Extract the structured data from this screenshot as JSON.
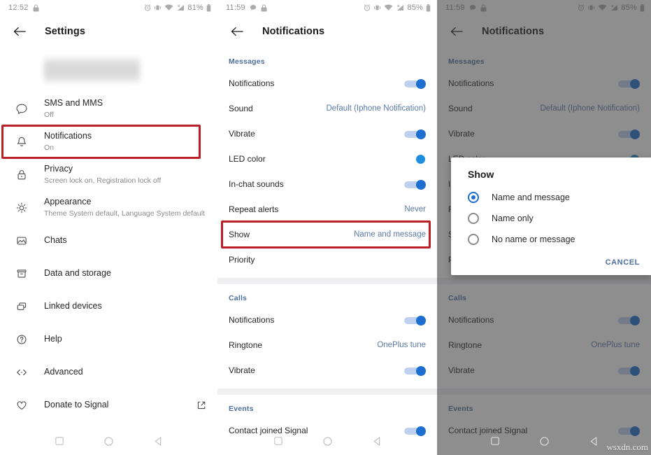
{
  "panels": {
    "left": {
      "statusbar": {
        "time": "12:52",
        "battery": "81%",
        "icons": [
          "lock-icon",
          "alarm-icon",
          "vibrate-icon",
          "wifi-icon",
          "signal-icon",
          "battery-icon"
        ]
      },
      "appbar": {
        "title": "Settings",
        "back": "back-arrow-icon"
      },
      "profile_redacted": true,
      "items": [
        {
          "icon": "chat-bubble-icon",
          "label": "SMS and MMS",
          "sub": "Off"
        },
        {
          "icon": "bell-icon",
          "label": "Notifications",
          "sub": "On",
          "highlighted": true
        },
        {
          "icon": "lock-icon",
          "label": "Privacy",
          "sub": "Screen lock on, Registration lock off"
        },
        {
          "icon": "brightness-icon",
          "label": "Appearance",
          "sub": "Theme System default, Language System default"
        },
        {
          "icon": "image-icon",
          "label": "Chats",
          "sub": ""
        },
        {
          "icon": "archive-icon",
          "label": "Data and storage",
          "sub": ""
        },
        {
          "icon": "devices-icon",
          "label": "Linked devices",
          "sub": ""
        },
        {
          "icon": "help-icon",
          "label": "Help",
          "sub": ""
        },
        {
          "icon": "code-icon",
          "label": "Advanced",
          "sub": ""
        },
        {
          "icon": "heart-icon",
          "label": "Donate to Signal",
          "sub": "",
          "external": "external-link-icon"
        }
      ]
    },
    "middle": {
      "statusbar": {
        "time": "11:59",
        "battery": "85%",
        "icons": [
          "message-icon",
          "lock-icon",
          "alarm-icon",
          "vibrate-icon",
          "wifi-icon",
          "signal-icon",
          "battery-icon"
        ]
      },
      "appbar": {
        "title": "Notifications",
        "back": "back-arrow-icon"
      },
      "sections": [
        {
          "title": "Messages",
          "rows": [
            {
              "label": "Notifications",
              "control": "toggle",
              "on": true
            },
            {
              "label": "Sound",
              "control": "value",
              "value": "Default (Iphone Notification)"
            },
            {
              "label": "Vibrate",
              "control": "toggle",
              "on": true
            },
            {
              "label": "LED color",
              "control": "swatch",
              "color": "#1e8fe0"
            },
            {
              "label": "In-chat sounds",
              "control": "toggle",
              "on": true
            },
            {
              "label": "Repeat alerts",
              "control": "value",
              "value": "Never"
            },
            {
              "label": "Show",
              "control": "value",
              "value": "Name and message",
              "highlighted": true
            },
            {
              "label": "Priority",
              "control": "none",
              "value": ""
            }
          ]
        },
        {
          "title": "Calls",
          "rows": [
            {
              "label": "Notifications",
              "control": "toggle",
              "on": true
            },
            {
              "label": "Ringtone",
              "control": "value",
              "value": "OnePlus tune"
            },
            {
              "label": "Vibrate",
              "control": "toggle",
              "on": true
            }
          ]
        },
        {
          "title": "Events",
          "rows": [
            {
              "label": "Contact joined Signal",
              "control": "toggle",
              "on": true
            }
          ]
        }
      ]
    },
    "right": {
      "statusbar": {
        "time": "11:59",
        "battery": "85%"
      },
      "appbar": {
        "title": "Notifications",
        "back": "back-arrow-icon"
      },
      "dialog": {
        "title": "Show",
        "options": [
          {
            "label": "Name and message",
            "selected": true
          },
          {
            "label": "Name only",
            "selected": false
          },
          {
            "label": "No name or message",
            "selected": false
          }
        ],
        "cancel_label": "CANCEL"
      }
    }
  },
  "navbar": {
    "recents": "square-icon",
    "home": "circle-icon",
    "back": "triangle-back-icon"
  },
  "watermark": "wsxdn.com",
  "colors": {
    "accent_blue": "#1c6fd0",
    "section_header": "#4e6f9e",
    "value_text": "#5b7aa8",
    "highlight_red": "#bb2026",
    "led_swatch": "#1e8fe0"
  }
}
